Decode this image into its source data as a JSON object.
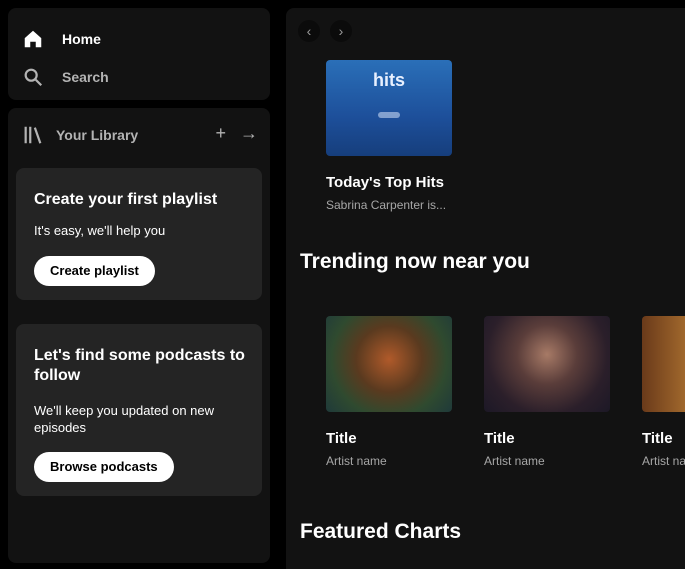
{
  "sidebar": {
    "nav": [
      {
        "label": "Home",
        "icon": "home-icon"
      },
      {
        "label": "Search",
        "icon": "search-icon"
      }
    ],
    "library": {
      "label": "Your Library",
      "add_icon": "plus-icon",
      "expand_icon": "arrow-right-icon"
    },
    "promos": [
      {
        "title": "Create your first playlist",
        "body": "It's easy, we'll help you",
        "button": "Create playlist"
      },
      {
        "title": "Let's find some podcasts to follow",
        "body": "We'll keep you updated on new episodes",
        "button": "Browse podcasts"
      }
    ]
  },
  "main": {
    "back_icon": "chevron-left-icon",
    "forward_icon": "chevron-right-icon",
    "top_card": {
      "art_text": "hits",
      "title": "Today's Top Hits",
      "subtitle": "Sabrina Carpenter is..."
    },
    "section1_title": "Trending now near you",
    "trending": [
      {
        "title": "Title",
        "subtitle": "Artist name"
      },
      {
        "title": "Title",
        "subtitle": "Artist name"
      },
      {
        "title": "Title",
        "subtitle": "Artist name"
      }
    ],
    "section2_title": "Featured Charts"
  },
  "colors": {
    "background": "#000000",
    "panel": "#121212",
    "promo": "#242424",
    "text_muted": "#b3b3b3"
  }
}
